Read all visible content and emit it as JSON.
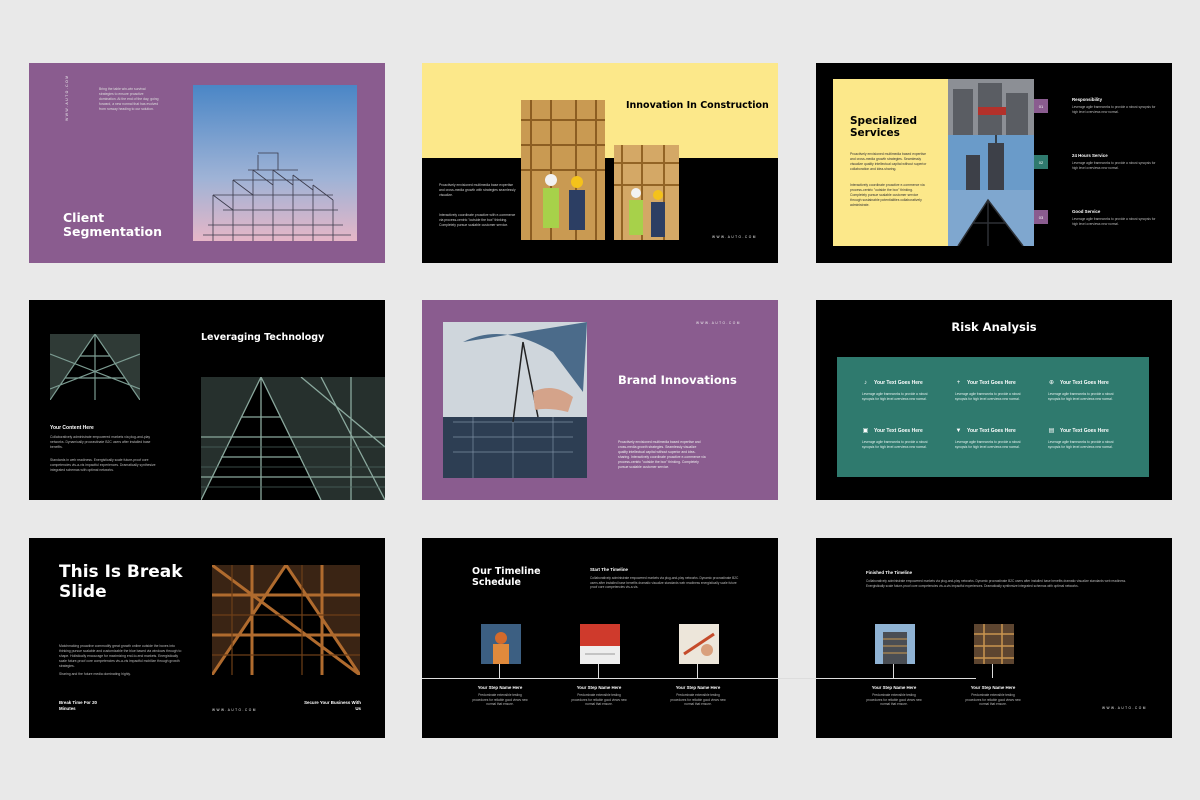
{
  "brand": "WWW.AUTO.COM",
  "colors": {
    "background": "#e9e9e9",
    "purple": "#8a5c8f",
    "yellow": "#fce88a",
    "teal": "#2f7a6e",
    "black": "#000000"
  },
  "s1": {
    "title": "Client Segmentation",
    "website": "WWW.AUTO.COM",
    "body": "Bring the table win-win survival strategies to ensure proactive domination. At the end of the day, going forward, a new normal that has evolved from runway heading to our solution."
  },
  "s2": {
    "title": "Innovation In Construction",
    "website": "WWW.AUTO.COM",
    "body1": "Proactively envisioned multimedia base expertise and cross-media growth with strategies seamlessly visualize.",
    "body2": "Interactively coordinate proactive with e-commerce via process-centric \"outside the box\" thinking. Completely pursue scalable customer service."
  },
  "s3": {
    "title": "Specialized Services",
    "body1": "Proactively envisioned multimedia based expertise and cross-media growth strategies. Seamlessly visualize quality intellectual capital without superior collaboration and idea-sharing.",
    "body2": "Interactively coordinate proactive e-commerce via process-centric \"outside the box\" thinking. Completely pursue scalable customer service through sustainable potentialities collaboratively administrate.",
    "items": [
      {
        "num": "01",
        "title": "Responsibility",
        "text": "Leverage agile frameworks to provide a robust synopsis for high level overviews new normal."
      },
      {
        "num": "02",
        "title": "24 Hours Service",
        "text": "Leverage agile frameworks to provide a robust synopsis for high level overviews new normal."
      },
      {
        "num": "03",
        "title": "Good Service",
        "text": "Leverage agile frameworks to provide a robust synopsis for high level overviews new normal."
      }
    ]
  },
  "s4": {
    "title": "Leveraging Technology",
    "subtitle": "Your Content Here",
    "body1": "Collaboratively administrate empowered markets via plug-and-play networks. Dynamically procrastinate B2C users after installed base benefits.",
    "body2": "Standards in web readiness. Energistically scale future-proof core competencies vis-a-vis impactful experiences. Dramatically synthesize integrated schemas with optimal networks."
  },
  "s5": {
    "title": "Brand Innovations",
    "website": "WWW.AUTO.COM",
    "body": "Proactively envisioned multimedia based expertise and cross-media growth strategies. Seamlessly visualize quality intellectual capital without superior and idea-sharing. Interactively coordinate proactive e-commerce via process-centric \"outside the box\" thinking. Completely pursue scalable customer service."
  },
  "s6": {
    "title": "Risk Analysis",
    "items": [
      {
        "icon": "bell-icon",
        "glyph": "♪",
        "title": "Your Text Goes Here",
        "text": "Leverage agile frameworks to provide a robust synopsis for high level overviews new normal."
      },
      {
        "icon": "plus-icon",
        "glyph": "+",
        "title": "Your Text Goes Here",
        "text": "Leverage agile frameworks to provide a robust synopsis for high level overviews new normal."
      },
      {
        "icon": "add-circle-icon",
        "glyph": "⊕",
        "title": "Your Text Goes Here",
        "text": "Leverage agile frameworks to provide a robust synopsis for high level overviews new normal."
      },
      {
        "icon": "lock-icon",
        "glyph": "▣",
        "title": "Your Text Goes Here",
        "text": "Leverage agile frameworks to provide a robust synopsis for high level overviews new normal."
      },
      {
        "icon": "location-pin-icon",
        "glyph": "▼",
        "title": "Your Text Goes Here",
        "text": "Leverage agile frameworks to provide a robust synopsis for high level overviews new normal."
      },
      {
        "icon": "document-icon",
        "glyph": "▤",
        "title": "Your Text Goes Here",
        "text": "Leverage agile frameworks to provide a robust synopsis for high level overviews new normal."
      }
    ]
  },
  "s7": {
    "title": "This Is Break Slide",
    "body": "Matchmaking proactive commodify great growth online outside the boxes into thinking pursue scalable and customizable the blue based via windows through to shape. Holistically encourage for maximizing end-to-end markets. Energistically scale future-proof core competencies vis-a-vis impactful mobilize through growth strategies.",
    "body2": "Sharing and the future media dominating highly.",
    "left_label": "Break Time For 20 Minutes",
    "right_label": "Secure Your Business With Us",
    "website": "WWW.AUTO.COM"
  },
  "s8": {
    "title": "Our Timeline Schedule",
    "heading": "Start The Timeline",
    "body": "Collaboratively administrate empowered markets via plug-and-play networks. Dynamic procrastinate B2C users after installed base benefits dramatic visualize standards web readiness energistically scale future proof core competencies vis-a-vis.",
    "steps": [
      {
        "title": "Your Step Name Here",
        "text": "Predominate extensible testing procedures for reliable good views new normal that ensure."
      },
      {
        "title": "Your Step Name Here",
        "text": "Predominate extensible testing procedures for reliable good views new normal that ensure."
      },
      {
        "title": "Your Step Name Here",
        "text": "Predominate extensible testing procedures for reliable good views new normal that ensure."
      }
    ]
  },
  "s9": {
    "heading": "Finished The Timeline",
    "body": "Collaboratively administrate empowered markets via plug-and-play networks. Dynamic procrastinate B2C users after installed base benefits dramatic visualize standards web readiness. Energistically scale future-proof core competencies vis-a-vis impactful experiences. Dramatically synthesize integrated schemas with optimal networks.",
    "website": "WWW.AUTO.COM",
    "steps": [
      {
        "title": "Your Step Name Here",
        "text": "Predominate extensible testing procedures for reliable good views new normal that ensure."
      },
      {
        "title": "Your Step Name Here",
        "text": "Predominate extensible testing procedures for reliable good views new normal that ensure."
      }
    ]
  }
}
